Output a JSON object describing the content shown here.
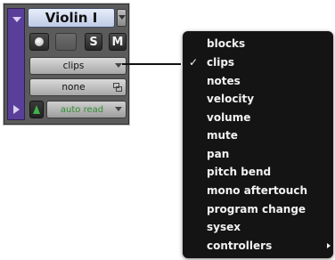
{
  "track": {
    "name": "Violin I",
    "solo_label": "S",
    "mute_label": "M",
    "view_selector": "clips",
    "playlist_selector": "none",
    "automation_mode": "auto read",
    "colors": {
      "track_strip": "#5a3f9a",
      "automation_text": "#2f8f2f"
    }
  },
  "menu": {
    "checked": "clips",
    "items": [
      {
        "label": "blocks",
        "check": ""
      },
      {
        "label": "clips",
        "check": "✓"
      },
      {
        "label": "notes",
        "check": ""
      },
      {
        "label": "velocity",
        "check": ""
      },
      {
        "label": "volume",
        "check": ""
      },
      {
        "label": "mute",
        "check": ""
      },
      {
        "label": "pan",
        "check": ""
      },
      {
        "label": "pitch bend",
        "check": ""
      },
      {
        "label": "mono aftertouch",
        "check": ""
      },
      {
        "label": "program change",
        "check": ""
      },
      {
        "label": "sysex",
        "check": ""
      },
      {
        "label": "controllers",
        "check": "",
        "submenu": "submenu-arrow-icon"
      }
    ]
  }
}
